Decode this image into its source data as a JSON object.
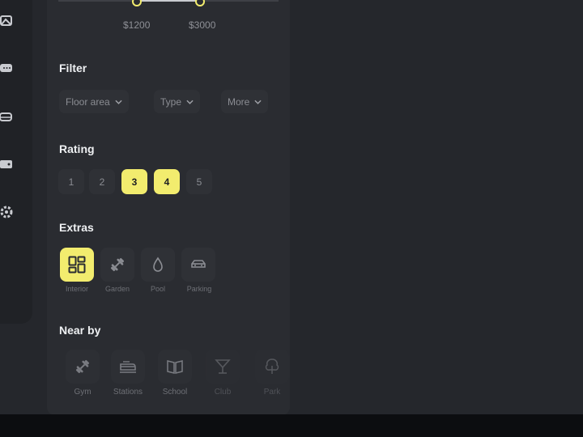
{
  "price_range": {
    "min_label": "$1200",
    "max_label": "$3000"
  },
  "filter": {
    "title": "Filter",
    "dropdowns": [
      {
        "label": "Floor area",
        "icon": "chevron-down-icon"
      },
      {
        "label": "Type",
        "icon": "chevron-down-icon"
      },
      {
        "label": "More",
        "icon": "chevron-down-icon"
      }
    ]
  },
  "rating": {
    "title": "Rating",
    "options": [
      "1",
      "2",
      "3",
      "4",
      "5"
    ],
    "selected": [
      "3",
      "4"
    ]
  },
  "extras": {
    "title": "Extras",
    "items": [
      {
        "label": "Interior",
        "icon": "layout-grid-icon",
        "selected": true
      },
      {
        "label": "Garden",
        "icon": "dumbbell-icon",
        "selected": false
      },
      {
        "label": "Pool",
        "icon": "drop-icon",
        "selected": false
      },
      {
        "label": "Parking",
        "icon": "car-icon",
        "selected": false
      }
    ]
  },
  "nearby": {
    "title": "Near by",
    "items": [
      {
        "label": "Gym",
        "icon": "dumbbell-icon"
      },
      {
        "label": "Stations",
        "icon": "train-icon"
      },
      {
        "label": "School",
        "icon": "book-icon"
      },
      {
        "label": "Club",
        "icon": "cocktail-icon"
      },
      {
        "label": "Park",
        "icon": "tree-icon"
      }
    ]
  },
  "rail_icons": [
    "image-icon",
    "chat-icon",
    "car-icon",
    "wallet-icon",
    "gear-icon"
  ],
  "colors": {
    "accent": "#f2ec6e",
    "panel": "#2a2c31",
    "background": "#25272c"
  }
}
